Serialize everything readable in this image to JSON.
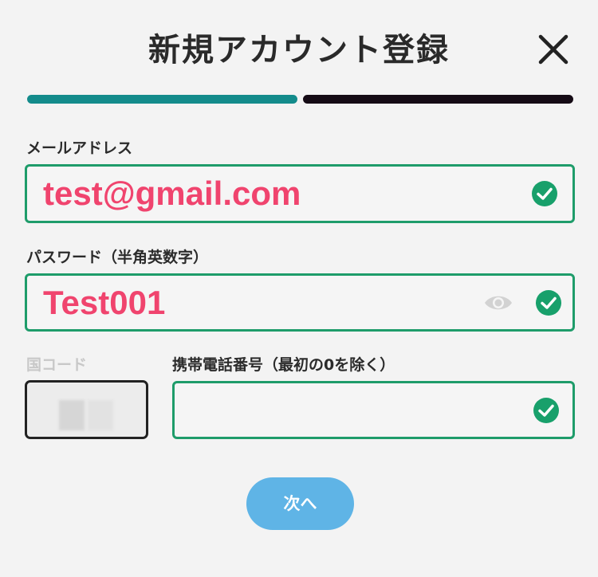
{
  "header": {
    "title": "新規アカウント登録",
    "close_icon": "close-icon"
  },
  "progress": {
    "steps_total": 2,
    "current_step": 1,
    "active_color": "#138b8b",
    "inactive_color": "#150b15"
  },
  "form": {
    "email": {
      "label": "メールアドレス",
      "value": "test@gmail.com",
      "valid": true,
      "status_icon": "check-circle-icon"
    },
    "password": {
      "label": "パスワード（半角英数字）",
      "value": "Test001",
      "valid": true,
      "visibility_icon": "eye-icon",
      "status_icon": "check-circle-icon"
    },
    "country_code": {
      "label": "国コード",
      "value": "",
      "disabled": true
    },
    "phone": {
      "label": "携帯電話番号（最初の0を除く）",
      "value": "",
      "valid": true,
      "status_icon": "check-circle-icon"
    }
  },
  "actions": {
    "next_label": "次へ"
  },
  "colors": {
    "valid_border": "#1e9c6a",
    "input_text": "#f0446e",
    "button": "#5fb4e6"
  }
}
